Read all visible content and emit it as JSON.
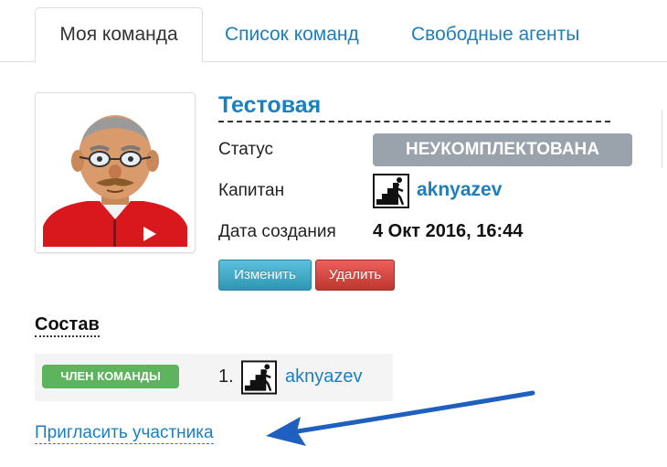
{
  "tabs": [
    {
      "label": "Моя команда",
      "active": true
    },
    {
      "label": "Список команд",
      "active": false
    },
    {
      "label": "Свободные агенты",
      "active": false
    }
  ],
  "team": {
    "name": "Тестовая",
    "status_label": "Статус",
    "status_value": "НЕУКОМПЛЕКТОВАНА",
    "captain_label": "Капитан",
    "captain_icon": "hiker-icon",
    "captain_name": "aknyazev",
    "created_label": "Дата создания",
    "created_value": "4 Окт 2016, 16:44"
  },
  "actions": {
    "edit_label": "Изменить",
    "delete_label": "Удалить"
  },
  "members": {
    "title": "Состав",
    "items": [
      {
        "role": "ЧЛЕН КОМАНДЫ",
        "number": "1.",
        "icon": "hiker-icon",
        "name": "aknyazev"
      }
    ],
    "invite_label": "Пригласить участника"
  },
  "colors": {
    "link": "#1b7fc0",
    "status_badge": "#9aa3ab",
    "member_badge": "#5eb45e",
    "edit_button": "#2f96b4",
    "delete_button": "#bd362f",
    "arrow": "#1f5fbf"
  }
}
